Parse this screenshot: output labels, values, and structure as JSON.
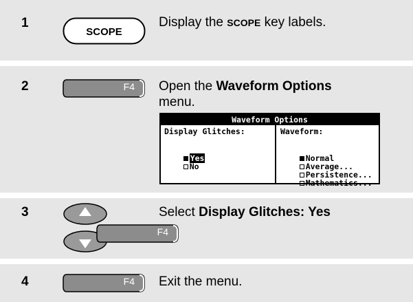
{
  "steps": [
    {
      "number": "1",
      "key": "SCOPE",
      "text_pre": "Display the ",
      "text_key": "SCOPE",
      "text_post": " key labels."
    },
    {
      "number": "2",
      "key": "F4",
      "text_pre": "Open the ",
      "text_bold": "Waveform Options",
      "text_post": "menu."
    },
    {
      "number": "3",
      "key": "F4",
      "text_pre": "Select ",
      "text_bold": "Display Glitches: Yes"
    },
    {
      "number": "4",
      "key": "F4",
      "text": "Exit the menu."
    }
  ],
  "menu": {
    "title": "Waveform Options",
    "left_header": "Display Glitches:",
    "left_options": [
      {
        "label": "Yes",
        "selected": true
      },
      {
        "label": "No",
        "selected": false
      }
    ],
    "right_header": "Waveform:",
    "right_options": [
      {
        "label": "Normal",
        "selected": true
      },
      {
        "label": "Average...",
        "selected": false
      },
      {
        "label": "Persistence...",
        "selected": false
      },
      {
        "label": "Mathematics...",
        "selected": false
      }
    ]
  },
  "colors": {
    "row_bg": "#e6e6e6",
    "key_gray": "#8c8c8c",
    "arrow_key_gray": "#9a9a9a"
  }
}
